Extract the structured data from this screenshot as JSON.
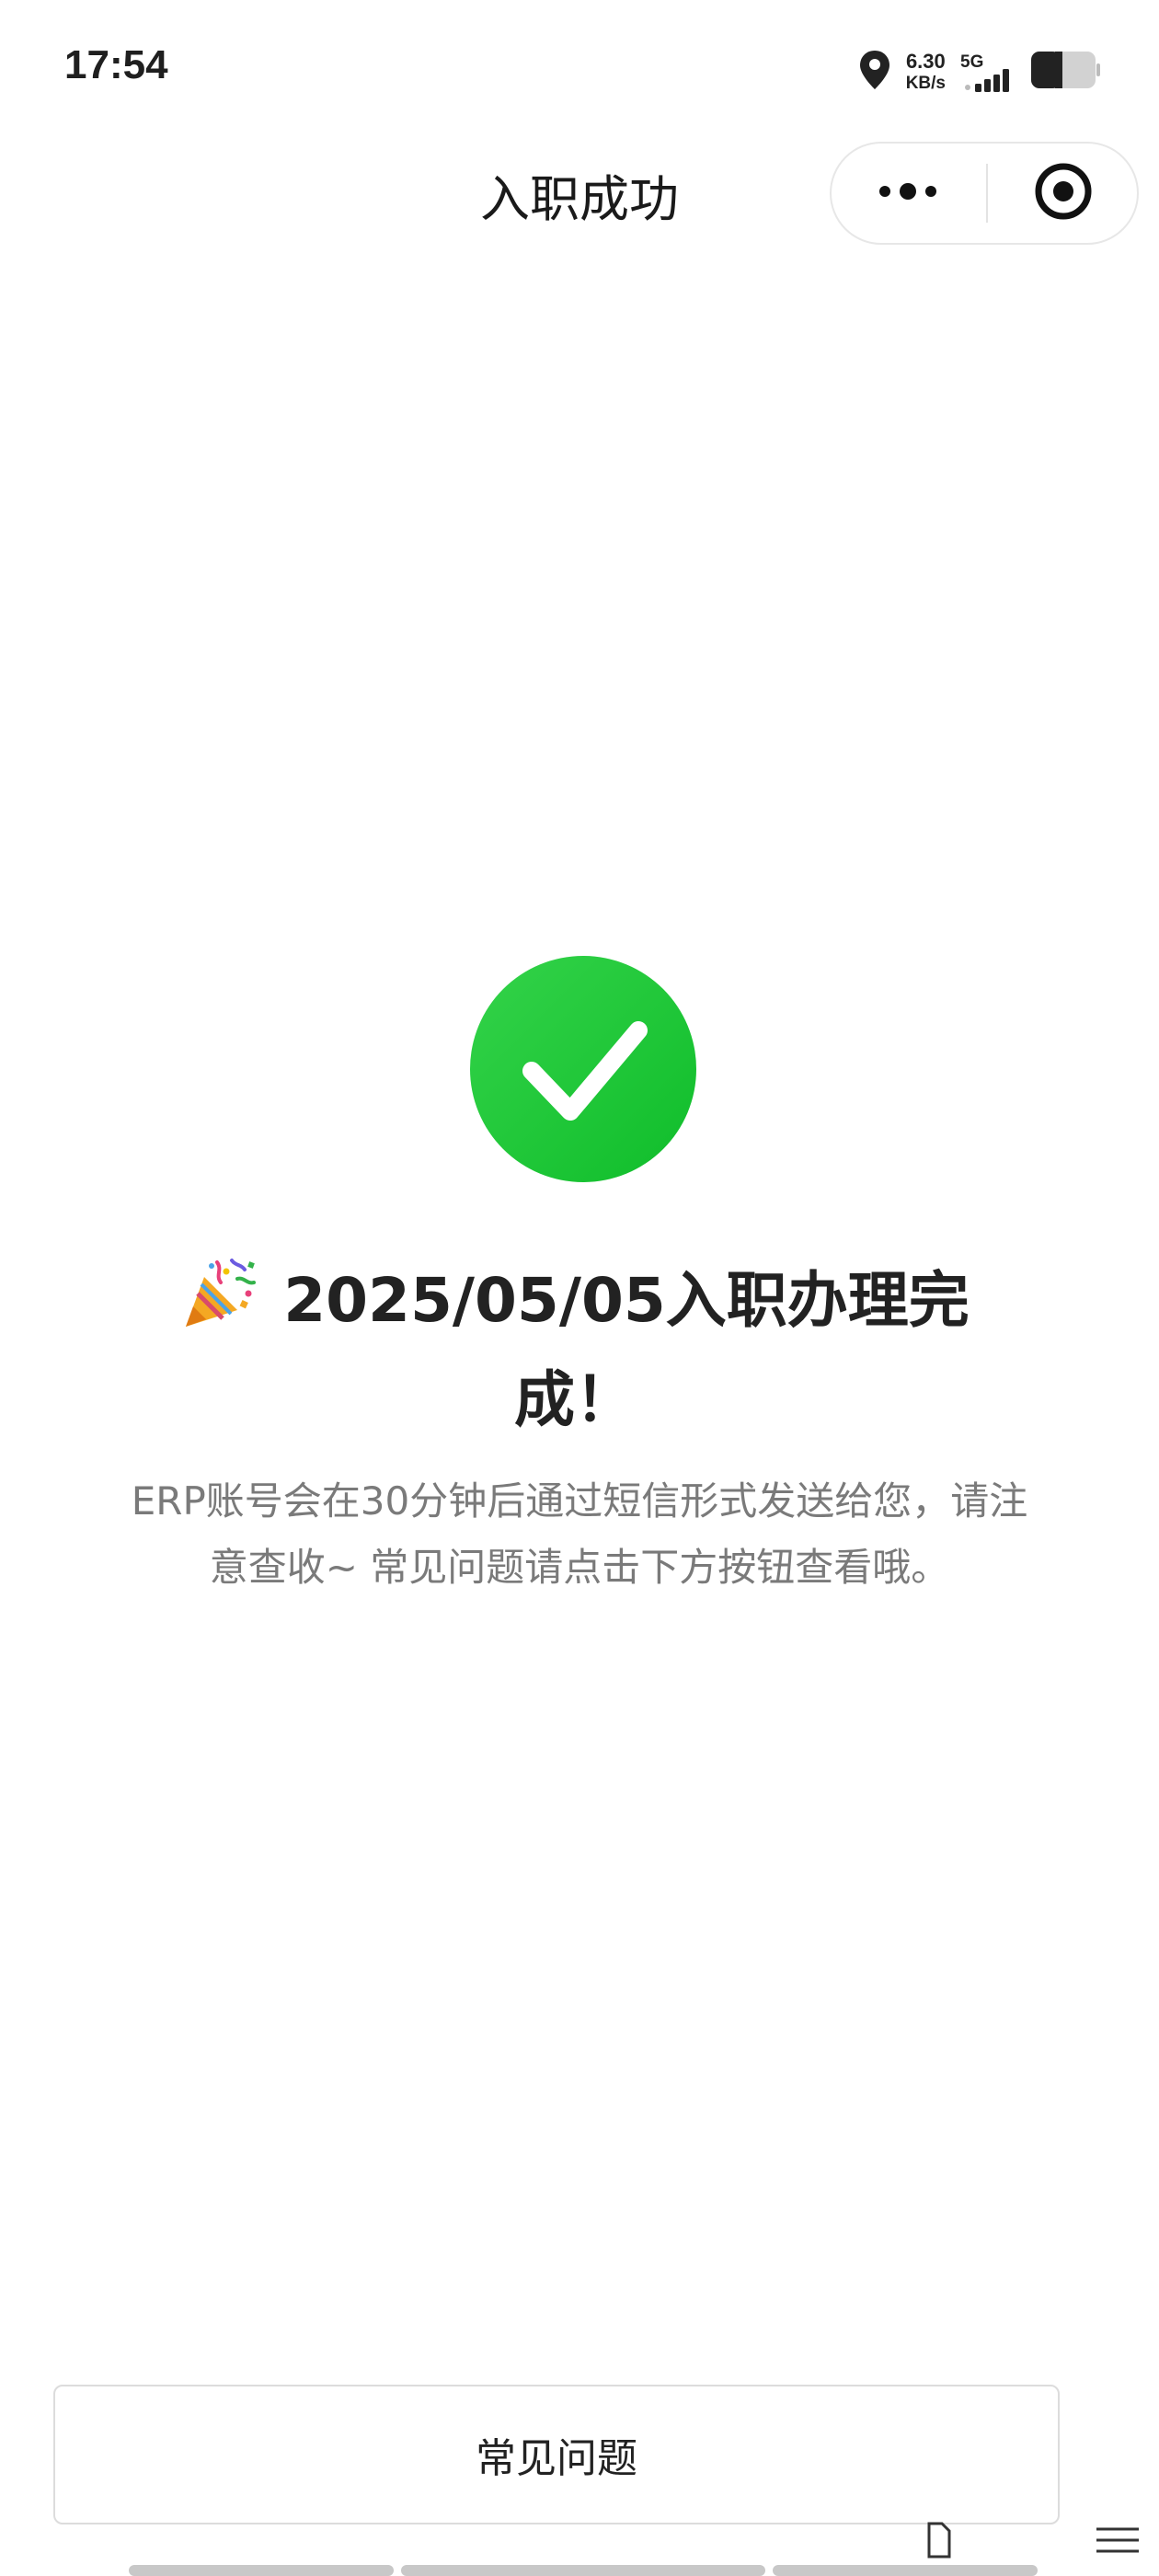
{
  "status_bar": {
    "time": "17:54",
    "net_speed_value": "6.30",
    "net_speed_unit": "KB/s",
    "network_type": "5G",
    "battery_level": 0.4,
    "icons": [
      "location-icon",
      "signal-icon",
      "battery-icon"
    ]
  },
  "nav": {
    "title": "入职成功",
    "capsule_icons": [
      "more-dots-icon",
      "close-target-icon"
    ]
  },
  "success": {
    "icon": "check-circle-icon",
    "color": "#1ec335",
    "headline_emoji_icon": "party-popper-icon",
    "headline": "2025/05/05入职办理完成！",
    "message": "ERP账号会在30分钟后通过短信形式发送给您，请注意查收~ 常见问题请点击下方按钮查看哦。"
  },
  "actions": {
    "faq_label": "常见问题"
  }
}
